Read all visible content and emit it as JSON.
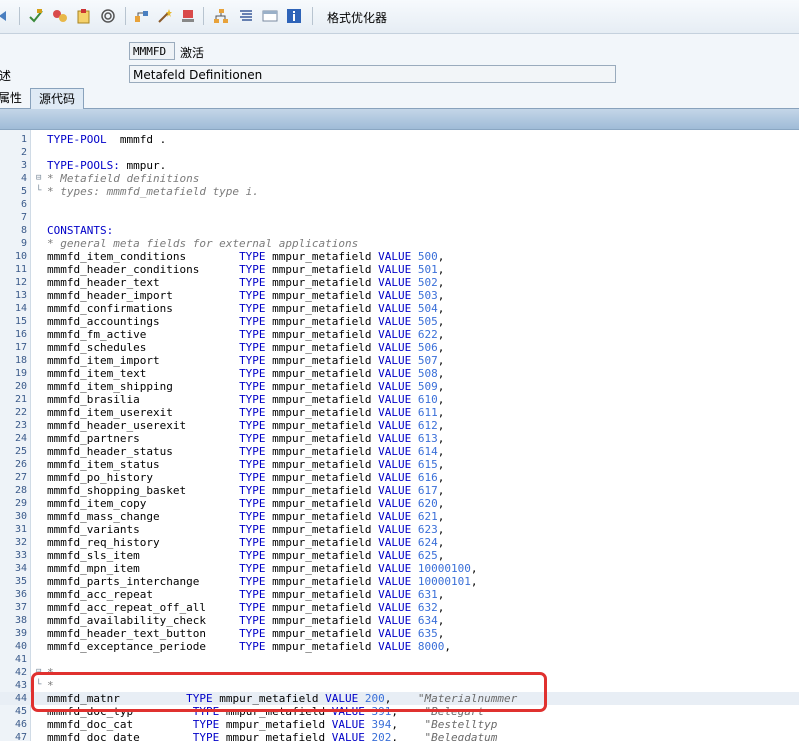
{
  "toolbar": {
    "format_label": "格式优化器",
    "icons": [
      "nav-arrow-icon",
      "check-icon",
      "activate-icon",
      "clipboard-icon",
      "target-icon",
      "tree-icon",
      "wand-icon",
      "stamp-icon",
      "hierarchy-icon",
      "pretty-print-icon",
      "window-icon",
      "info-icon"
    ]
  },
  "header": {
    "name_value": "MMMFD",
    "status_label": "激活",
    "desc_label": "述",
    "desc_value": "Metafeld Definitionen"
  },
  "tabs": [
    {
      "label": "属性"
    },
    {
      "label": "源代码"
    }
  ],
  "lines": [
    {
      "n": "1",
      "f": "",
      "t": [
        [
          "kw",
          "TYPE-POOL"
        ],
        [
          "",
          "  mmmfd ."
        ]
      ]
    },
    {
      "n": "2",
      "f": "",
      "t": []
    },
    {
      "n": "3",
      "f": "",
      "t": [
        [
          "kw",
          "TYPE-POOLS:"
        ],
        [
          "",
          " mmpur."
        ]
      ]
    },
    {
      "n": "4",
      "f": "⊟",
      "t": [
        [
          "cmt",
          "* Metafield definitions"
        ]
      ]
    },
    {
      "n": "5",
      "f": "└",
      "t": [
        [
          "cmt",
          "* types: mmmfd_metafield type i."
        ]
      ]
    },
    {
      "n": "6",
      "f": "",
      "t": []
    },
    {
      "n": "7",
      "f": "",
      "t": []
    },
    {
      "n": "8",
      "f": "",
      "t": [
        [
          "kw",
          "CONSTANTS:"
        ]
      ]
    },
    {
      "n": "9",
      "f": "",
      "t": [
        [
          "cmt",
          "* general meta fields for external applications"
        ]
      ]
    },
    {
      "n": "10",
      "f": "",
      "t": [
        [
          "",
          "mmmfd_item_conditions        "
        ],
        [
          "kw",
          "TYPE"
        ],
        [
          "",
          " mmpur_metafield "
        ],
        [
          "kw",
          "VALUE"
        ],
        [
          "",
          " "
        ],
        [
          "num",
          "500"
        ],
        [
          "",
          ","
        ]
      ]
    },
    {
      "n": "11",
      "f": "",
      "t": [
        [
          "",
          "mmmfd_header_conditions      "
        ],
        [
          "kw",
          "TYPE"
        ],
        [
          "",
          " mmpur_metafield "
        ],
        [
          "kw",
          "VALUE"
        ],
        [
          "",
          " "
        ],
        [
          "num",
          "501"
        ],
        [
          "",
          ","
        ]
      ]
    },
    {
      "n": "12",
      "f": "",
      "t": [
        [
          "",
          "mmmfd_header_text            "
        ],
        [
          "kw",
          "TYPE"
        ],
        [
          "",
          " mmpur_metafield "
        ],
        [
          "kw",
          "VALUE"
        ],
        [
          "",
          " "
        ],
        [
          "num",
          "502"
        ],
        [
          "",
          ","
        ]
      ]
    },
    {
      "n": "13",
      "f": "",
      "t": [
        [
          "",
          "mmmfd_header_import          "
        ],
        [
          "kw",
          "TYPE"
        ],
        [
          "",
          " mmpur_metafield "
        ],
        [
          "kw",
          "VALUE"
        ],
        [
          "",
          " "
        ],
        [
          "num",
          "503"
        ],
        [
          "",
          ","
        ]
      ]
    },
    {
      "n": "14",
      "f": "",
      "t": [
        [
          "",
          "mmmfd_confirmations          "
        ],
        [
          "kw",
          "TYPE"
        ],
        [
          "",
          " mmpur_metafield "
        ],
        [
          "kw",
          "VALUE"
        ],
        [
          "",
          " "
        ],
        [
          "num",
          "504"
        ],
        [
          "",
          ","
        ]
      ]
    },
    {
      "n": "15",
      "f": "",
      "t": [
        [
          "",
          "mmmfd_accountings            "
        ],
        [
          "kw",
          "TYPE"
        ],
        [
          "",
          " mmpur_metafield "
        ],
        [
          "kw",
          "VALUE"
        ],
        [
          "",
          " "
        ],
        [
          "num",
          "505"
        ],
        [
          "",
          ","
        ]
      ]
    },
    {
      "n": "16",
      "f": "",
      "t": [
        [
          "",
          "mmmfd_fm_active              "
        ],
        [
          "kw",
          "TYPE"
        ],
        [
          "",
          " mmpur_metafield "
        ],
        [
          "kw",
          "VALUE"
        ],
        [
          "",
          " "
        ],
        [
          "num",
          "622"
        ],
        [
          "",
          ","
        ]
      ]
    },
    {
      "n": "17",
      "f": "",
      "t": [
        [
          "",
          "mmmfd_schedules              "
        ],
        [
          "kw",
          "TYPE"
        ],
        [
          "",
          " mmpur_metafield "
        ],
        [
          "kw",
          "VALUE"
        ],
        [
          "",
          " "
        ],
        [
          "num",
          "506"
        ],
        [
          "",
          ","
        ]
      ]
    },
    {
      "n": "18",
      "f": "",
      "t": [
        [
          "",
          "mmmfd_item_import            "
        ],
        [
          "kw",
          "TYPE"
        ],
        [
          "",
          " mmpur_metafield "
        ],
        [
          "kw",
          "VALUE"
        ],
        [
          "",
          " "
        ],
        [
          "num",
          "507"
        ],
        [
          "",
          ","
        ]
      ]
    },
    {
      "n": "19",
      "f": "",
      "t": [
        [
          "",
          "mmmfd_item_text              "
        ],
        [
          "kw",
          "TYPE"
        ],
        [
          "",
          " mmpur_metafield "
        ],
        [
          "kw",
          "VALUE"
        ],
        [
          "",
          " "
        ],
        [
          "num",
          "508"
        ],
        [
          "",
          ","
        ]
      ]
    },
    {
      "n": "20",
      "f": "",
      "t": [
        [
          "",
          "mmmfd_item_shipping          "
        ],
        [
          "kw",
          "TYPE"
        ],
        [
          "",
          " mmpur_metafield "
        ],
        [
          "kw",
          "VALUE"
        ],
        [
          "",
          " "
        ],
        [
          "num",
          "509"
        ],
        [
          "",
          ","
        ]
      ]
    },
    {
      "n": "21",
      "f": "",
      "t": [
        [
          "",
          "mmmfd_brasilia               "
        ],
        [
          "kw",
          "TYPE"
        ],
        [
          "",
          " mmpur_metafield "
        ],
        [
          "kw",
          "VALUE"
        ],
        [
          "",
          " "
        ],
        [
          "num",
          "610"
        ],
        [
          "",
          ","
        ]
      ]
    },
    {
      "n": "22",
      "f": "",
      "t": [
        [
          "",
          "mmmfd_item_userexit          "
        ],
        [
          "kw",
          "TYPE"
        ],
        [
          "",
          " mmpur_metafield "
        ],
        [
          "kw",
          "VALUE"
        ],
        [
          "",
          " "
        ],
        [
          "num",
          "611"
        ],
        [
          "",
          ","
        ]
      ]
    },
    {
      "n": "23",
      "f": "",
      "t": [
        [
          "",
          "mmmfd_header_userexit        "
        ],
        [
          "kw",
          "TYPE"
        ],
        [
          "",
          " mmpur_metafield "
        ],
        [
          "kw",
          "VALUE"
        ],
        [
          "",
          " "
        ],
        [
          "num",
          "612"
        ],
        [
          "",
          ","
        ]
      ]
    },
    {
      "n": "24",
      "f": "",
      "t": [
        [
          "",
          "mmmfd_partners               "
        ],
        [
          "kw",
          "TYPE"
        ],
        [
          "",
          " mmpur_metafield "
        ],
        [
          "kw",
          "VALUE"
        ],
        [
          "",
          " "
        ],
        [
          "num",
          "613"
        ],
        [
          "",
          ","
        ]
      ]
    },
    {
      "n": "25",
      "f": "",
      "t": [
        [
          "",
          "mmmfd_header_status          "
        ],
        [
          "kw",
          "TYPE"
        ],
        [
          "",
          " mmpur_metafield "
        ],
        [
          "kw",
          "VALUE"
        ],
        [
          "",
          " "
        ],
        [
          "num",
          "614"
        ],
        [
          "",
          ","
        ]
      ]
    },
    {
      "n": "26",
      "f": "",
      "t": [
        [
          "",
          "mmmfd_item_status            "
        ],
        [
          "kw",
          "TYPE"
        ],
        [
          "",
          " mmpur_metafield "
        ],
        [
          "kw",
          "VALUE"
        ],
        [
          "",
          " "
        ],
        [
          "num",
          "615"
        ],
        [
          "",
          ","
        ]
      ]
    },
    {
      "n": "27",
      "f": "",
      "t": [
        [
          "",
          "mmmfd_po_history             "
        ],
        [
          "kw",
          "TYPE"
        ],
        [
          "",
          " mmpur_metafield "
        ],
        [
          "kw",
          "VALUE"
        ],
        [
          "",
          " "
        ],
        [
          "num",
          "616"
        ],
        [
          "",
          ","
        ]
      ]
    },
    {
      "n": "28",
      "f": "",
      "t": [
        [
          "",
          "mmmfd_shopping_basket        "
        ],
        [
          "kw",
          "TYPE"
        ],
        [
          "",
          " mmpur_metafield "
        ],
        [
          "kw",
          "VALUE"
        ],
        [
          "",
          " "
        ],
        [
          "num",
          "617"
        ],
        [
          "",
          ","
        ]
      ]
    },
    {
      "n": "29",
      "f": "",
      "t": [
        [
          "",
          "mmmfd_item_copy              "
        ],
        [
          "kw",
          "TYPE"
        ],
        [
          "",
          " mmpur_metafield "
        ],
        [
          "kw",
          "VALUE"
        ],
        [
          "",
          " "
        ],
        [
          "num",
          "620"
        ],
        [
          "",
          ","
        ]
      ]
    },
    {
      "n": "30",
      "f": "",
      "t": [
        [
          "",
          "mmmfd_mass_change            "
        ],
        [
          "kw",
          "TYPE"
        ],
        [
          "",
          " mmpur_metafield "
        ],
        [
          "kw",
          "VALUE"
        ],
        [
          "",
          " "
        ],
        [
          "num",
          "621"
        ],
        [
          "",
          ","
        ]
      ]
    },
    {
      "n": "31",
      "f": "",
      "t": [
        [
          "",
          "mmmfd_variants               "
        ],
        [
          "kw",
          "TYPE"
        ],
        [
          "",
          " mmpur_metafield "
        ],
        [
          "kw",
          "VALUE"
        ],
        [
          "",
          " "
        ],
        [
          "num",
          "623"
        ],
        [
          "",
          ","
        ]
      ]
    },
    {
      "n": "32",
      "f": "",
      "t": [
        [
          "",
          "mmmfd_req_history            "
        ],
        [
          "kw",
          "TYPE"
        ],
        [
          "",
          " mmpur_metafield "
        ],
        [
          "kw",
          "VALUE"
        ],
        [
          "",
          " "
        ],
        [
          "num",
          "624"
        ],
        [
          "",
          ","
        ]
      ]
    },
    {
      "n": "33",
      "f": "",
      "t": [
        [
          "",
          "mmmfd_sls_item               "
        ],
        [
          "kw",
          "TYPE"
        ],
        [
          "",
          " mmpur_metafield "
        ],
        [
          "kw",
          "VALUE"
        ],
        [
          "",
          " "
        ],
        [
          "num",
          "625"
        ],
        [
          "",
          ","
        ]
      ]
    },
    {
      "n": "34",
      "f": "",
      "t": [
        [
          "",
          "mmmfd_mpn_item               "
        ],
        [
          "kw",
          "TYPE"
        ],
        [
          "",
          " mmpur_metafield "
        ],
        [
          "kw",
          "VALUE"
        ],
        [
          "",
          " "
        ],
        [
          "num",
          "10000100"
        ],
        [
          "",
          ","
        ]
      ]
    },
    {
      "n": "35",
      "f": "",
      "t": [
        [
          "",
          "mmmfd_parts_interchange      "
        ],
        [
          "kw",
          "TYPE"
        ],
        [
          "",
          " mmpur_metafield "
        ],
        [
          "kw",
          "VALUE"
        ],
        [
          "",
          " "
        ],
        [
          "num",
          "10000101"
        ],
        [
          "",
          ","
        ]
      ]
    },
    {
      "n": "36",
      "f": "",
      "t": [
        [
          "",
          "mmmfd_acc_repeat             "
        ],
        [
          "kw",
          "TYPE"
        ],
        [
          "",
          " mmpur_metafield "
        ],
        [
          "kw",
          "VALUE"
        ],
        [
          "",
          " "
        ],
        [
          "num",
          "631"
        ],
        [
          "",
          ","
        ]
      ]
    },
    {
      "n": "37",
      "f": "",
      "t": [
        [
          "",
          "mmmfd_acc_repeat_off_all     "
        ],
        [
          "kw",
          "TYPE"
        ],
        [
          "",
          " mmpur_metafield "
        ],
        [
          "kw",
          "VALUE"
        ],
        [
          "",
          " "
        ],
        [
          "num",
          "632"
        ],
        [
          "",
          ","
        ]
      ]
    },
    {
      "n": "38",
      "f": "",
      "t": [
        [
          "",
          "mmmfd_availability_check     "
        ],
        [
          "kw",
          "TYPE"
        ],
        [
          "",
          " mmpur_metafield "
        ],
        [
          "kw",
          "VALUE"
        ],
        [
          "",
          " "
        ],
        [
          "num",
          "634"
        ],
        [
          "",
          ","
        ]
      ]
    },
    {
      "n": "39",
      "f": "",
      "t": [
        [
          "",
          "mmmfd_header_text_button     "
        ],
        [
          "kw",
          "TYPE"
        ],
        [
          "",
          " mmpur_metafield "
        ],
        [
          "kw",
          "VALUE"
        ],
        [
          "",
          " "
        ],
        [
          "num",
          "635"
        ],
        [
          "",
          ","
        ]
      ]
    },
    {
      "n": "40",
      "f": "",
      "t": [
        [
          "",
          "mmmfd_exceptance_periode     "
        ],
        [
          "kw",
          "TYPE"
        ],
        [
          "",
          " mmpur_metafield "
        ],
        [
          "kw",
          "VALUE"
        ],
        [
          "",
          " "
        ],
        [
          "num",
          "8000"
        ],
        [
          "",
          ","
        ]
      ]
    },
    {
      "n": "41",
      "f": "",
      "t": []
    },
    {
      "n": "42",
      "f": "⊟",
      "t": [
        [
          "cmt",
          "*"
        ]
      ]
    },
    {
      "n": "43",
      "f": "└",
      "t": [
        [
          "cmt",
          "*"
        ]
      ]
    },
    {
      "n": "44",
      "f": "",
      "h": true,
      "t": [
        [
          "",
          "mmmfd_matnr          "
        ],
        [
          "kw",
          "TYPE"
        ],
        [
          "",
          " mmpur_metafield "
        ],
        [
          "kw",
          "VALUE"
        ],
        [
          "",
          " "
        ],
        [
          "num",
          "200"
        ],
        [
          "",
          ",    "
        ],
        [
          "str",
          "\"Materialnummer"
        ]
      ]
    },
    {
      "n": "45",
      "f": "",
      "t": [
        [
          "",
          "mmmfd_doc_typ         "
        ],
        [
          "kw",
          "TYPE"
        ],
        [
          "",
          " mmpur_metafield "
        ],
        [
          "kw",
          "VALUE"
        ],
        [
          "",
          " "
        ],
        [
          "num",
          "391"
        ],
        [
          "",
          ",    "
        ],
        [
          "str",
          "\"Belegart"
        ]
      ]
    },
    {
      "n": "46",
      "f": "",
      "t": [
        [
          "",
          "mmmfd_doc_cat         "
        ],
        [
          "kw",
          "TYPE"
        ],
        [
          "",
          " mmpur_metafield "
        ],
        [
          "kw",
          "VALUE"
        ],
        [
          "",
          " "
        ],
        [
          "num",
          "394"
        ],
        [
          "",
          ",    "
        ],
        [
          "str",
          "\"Bestelltyp"
        ]
      ]
    },
    {
      "n": "47",
      "f": "",
      "t": [
        [
          "",
          "mmmfd_doc_date        "
        ],
        [
          "kw",
          "TYPE"
        ],
        [
          "",
          " mmpur_metafield "
        ],
        [
          "kw",
          "VALUE"
        ],
        [
          "",
          " "
        ],
        [
          "num",
          "202"
        ],
        [
          "",
          ",    "
        ],
        [
          "str",
          "\"Belegdatum"
        ]
      ]
    }
  ]
}
